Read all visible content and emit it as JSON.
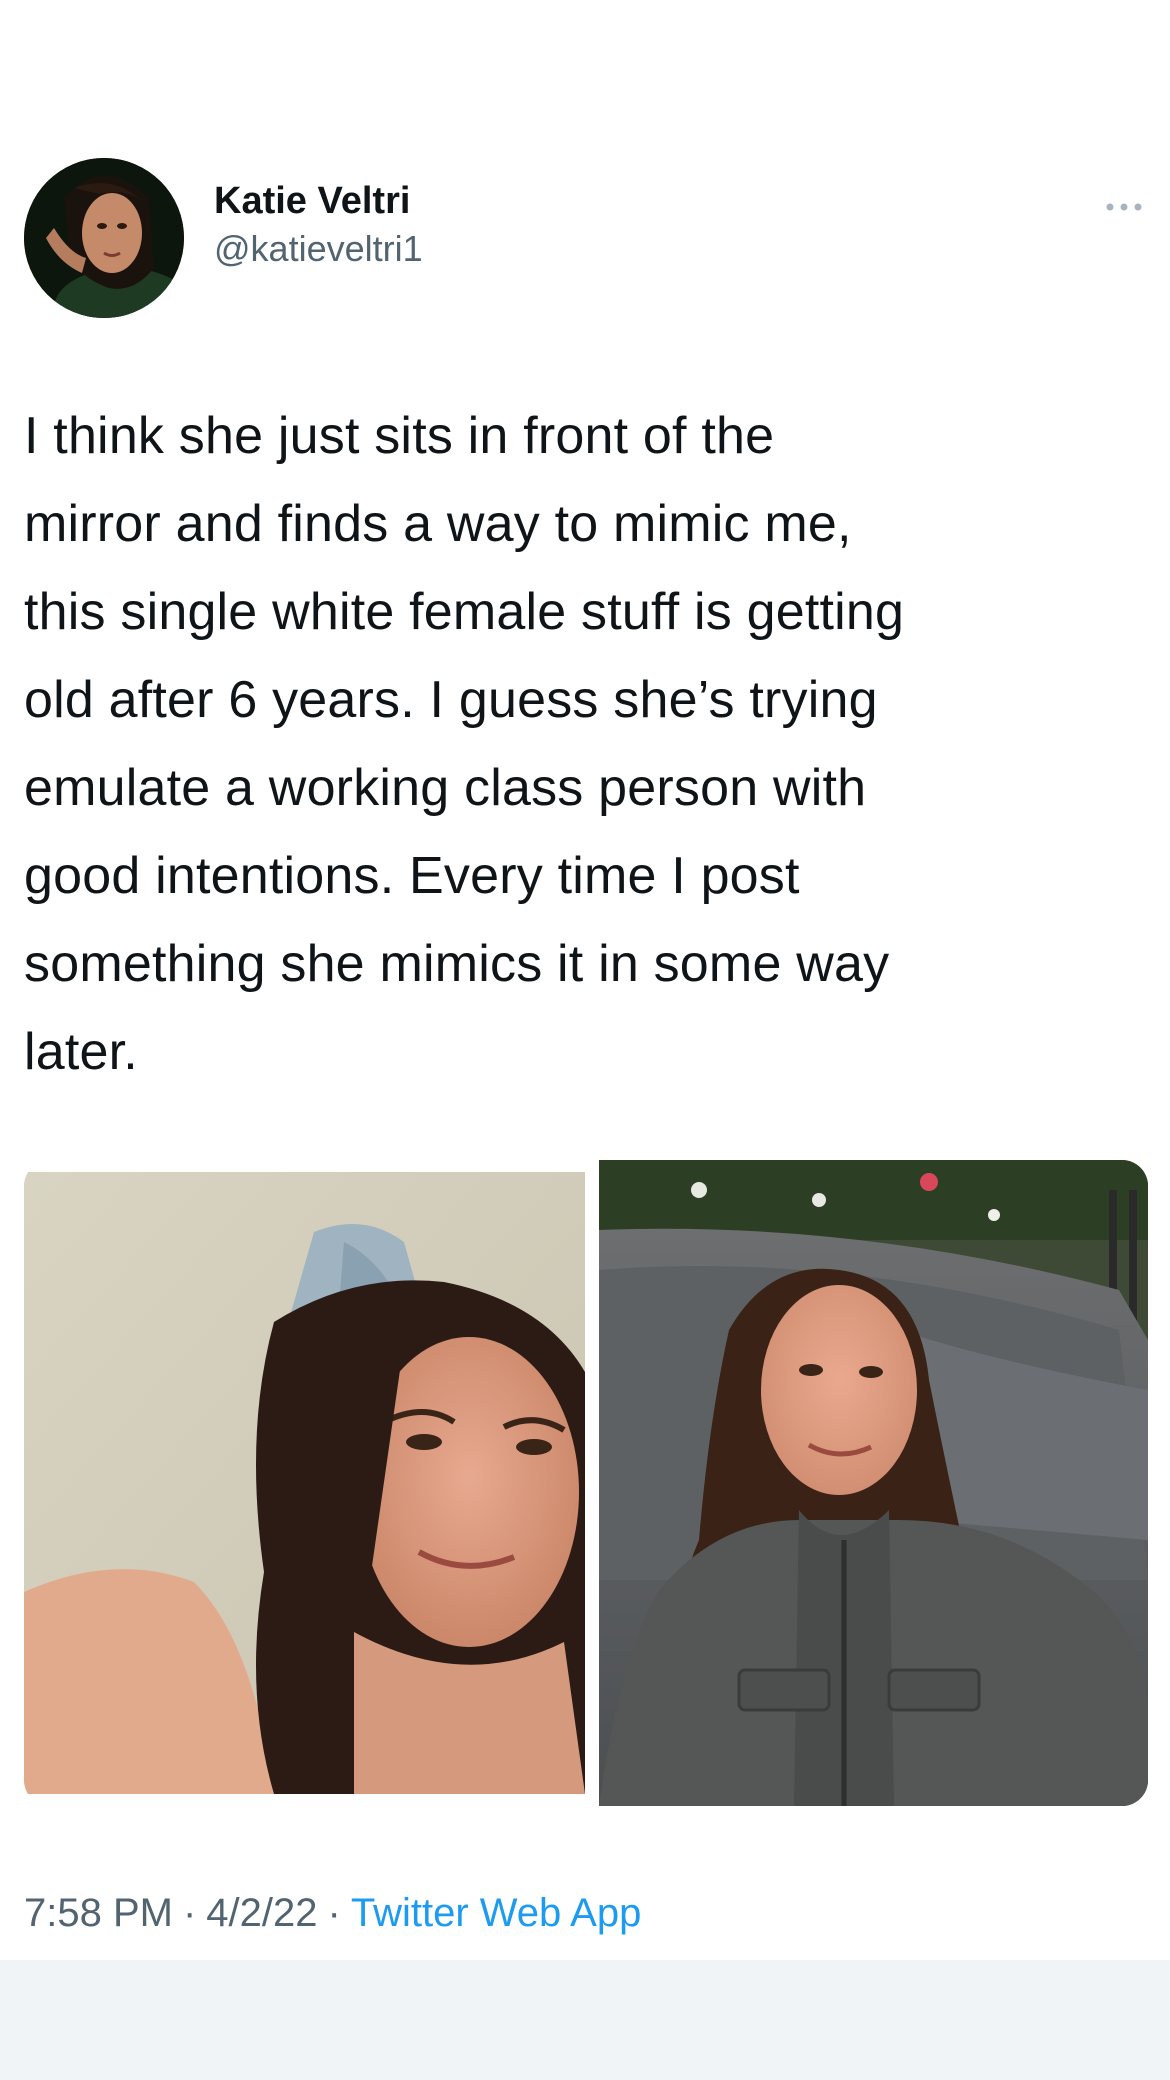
{
  "author": {
    "name": "Katie Veltri",
    "handle": "@katieveltri1",
    "avatar_icon": "profile-photo"
  },
  "more_icon": "more-options-icon",
  "tweet": {
    "lines": [
      "I think she just sits in front of the",
      "mirror and finds a way to mimic me,",
      "this single white female stuff is getting",
      "old after 6 years. I guess she’s trying",
      "emulate a working class person with",
      "good intentions. Every time I post",
      "something she mimics it in some way",
      "later."
    ]
  },
  "media": {
    "photos": [
      {
        "description_icon": "selfie-photo"
      },
      {
        "description_icon": "photo-by-car"
      }
    ]
  },
  "meta": {
    "time": "7:58 PM",
    "separator": "·",
    "date": "4/2/22",
    "source": "Twitter Web App"
  },
  "colors": {
    "text": "#0f1419",
    "secondary": "#536471",
    "link": "#1d9bf0",
    "band": "#f1f4f7"
  }
}
